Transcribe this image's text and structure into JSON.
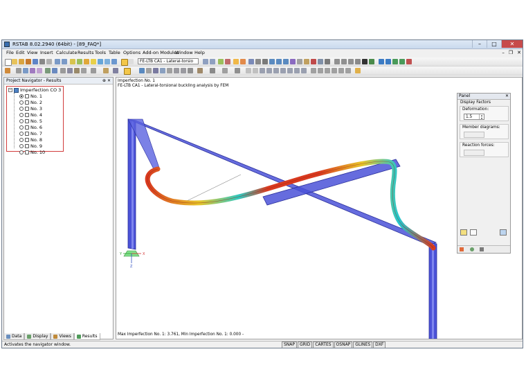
{
  "app": {
    "title": "RSTAB 8.02.2940 (64bit) - [89_FAQ*]",
    "window_buttons": [
      "–",
      "□",
      "✕"
    ]
  },
  "menu": [
    "File",
    "Edit",
    "View",
    "Insert",
    "Calculate",
    "Results",
    "Tools",
    "Table",
    "Options",
    "Add-on Modules",
    "Window",
    "Help"
  ],
  "menu_mdi_buttons": [
    "–",
    "❐",
    "✕"
  ],
  "toolbar": {
    "module_combo": "FE-LTB CA1 - Lateral-torsio"
  },
  "navigator": {
    "title": "Project Navigator - Results",
    "header_buttons": "⊕ ✕",
    "root": {
      "expander": "−",
      "label": "Imperfection CO 3"
    },
    "items": [
      {
        "label": "No. 1",
        "selected": true
      },
      {
        "label": "No. 2",
        "selected": false
      },
      {
        "label": "No. 3",
        "selected": false
      },
      {
        "label": "No. 4",
        "selected": false
      },
      {
        "label": "No. 5",
        "selected": false
      },
      {
        "label": "No. 6",
        "selected": false
      },
      {
        "label": "No. 7",
        "selected": false
      },
      {
        "label": "No. 8",
        "selected": false
      },
      {
        "label": "No. 9",
        "selected": false
      },
      {
        "label": "No. 10",
        "selected": false
      }
    ],
    "tabs": [
      {
        "label": "Data",
        "icon": "data-icon",
        "color": "#6a8fbf"
      },
      {
        "label": "Display",
        "icon": "display-icon",
        "color": "#6aa06a"
      },
      {
        "label": "Views",
        "icon": "views-icon",
        "color": "#c08a3a"
      },
      {
        "label": "Results",
        "icon": "results-icon",
        "color": "#4f9b5a"
      }
    ],
    "active_tab": "Results"
  },
  "view": {
    "line1": "Imperfection No. 1",
    "line2": "FE-LTB CA1 - Lateral-torsional buckling analysis by FEM",
    "footer": "Max Imperfection No. 1: 3.761, Min Imperfection No. 1: 0.000 -",
    "axis_labels": {
      "x": "X",
      "y": "Y",
      "z": "Z"
    }
  },
  "panel": {
    "title": "Panel",
    "close": "✕",
    "section": "Display Factors",
    "deformation_label": "Deformation:",
    "deformation_value": "1.5",
    "member_diagrams_label": "Member diagrams:",
    "reaction_forces_label": "Reaction forces:"
  },
  "status": {
    "text": "Activates the navigator window.",
    "buttons": [
      "SNAP",
      "GRID",
      "CARTES",
      "OSNAP",
      "GLINES",
      "DXF"
    ]
  },
  "colors": {
    "member": "#3d4fd6",
    "deform_low": "#d63a1f",
    "deform_high": "#20c0c8",
    "highlight_border": "#d13b3b"
  }
}
